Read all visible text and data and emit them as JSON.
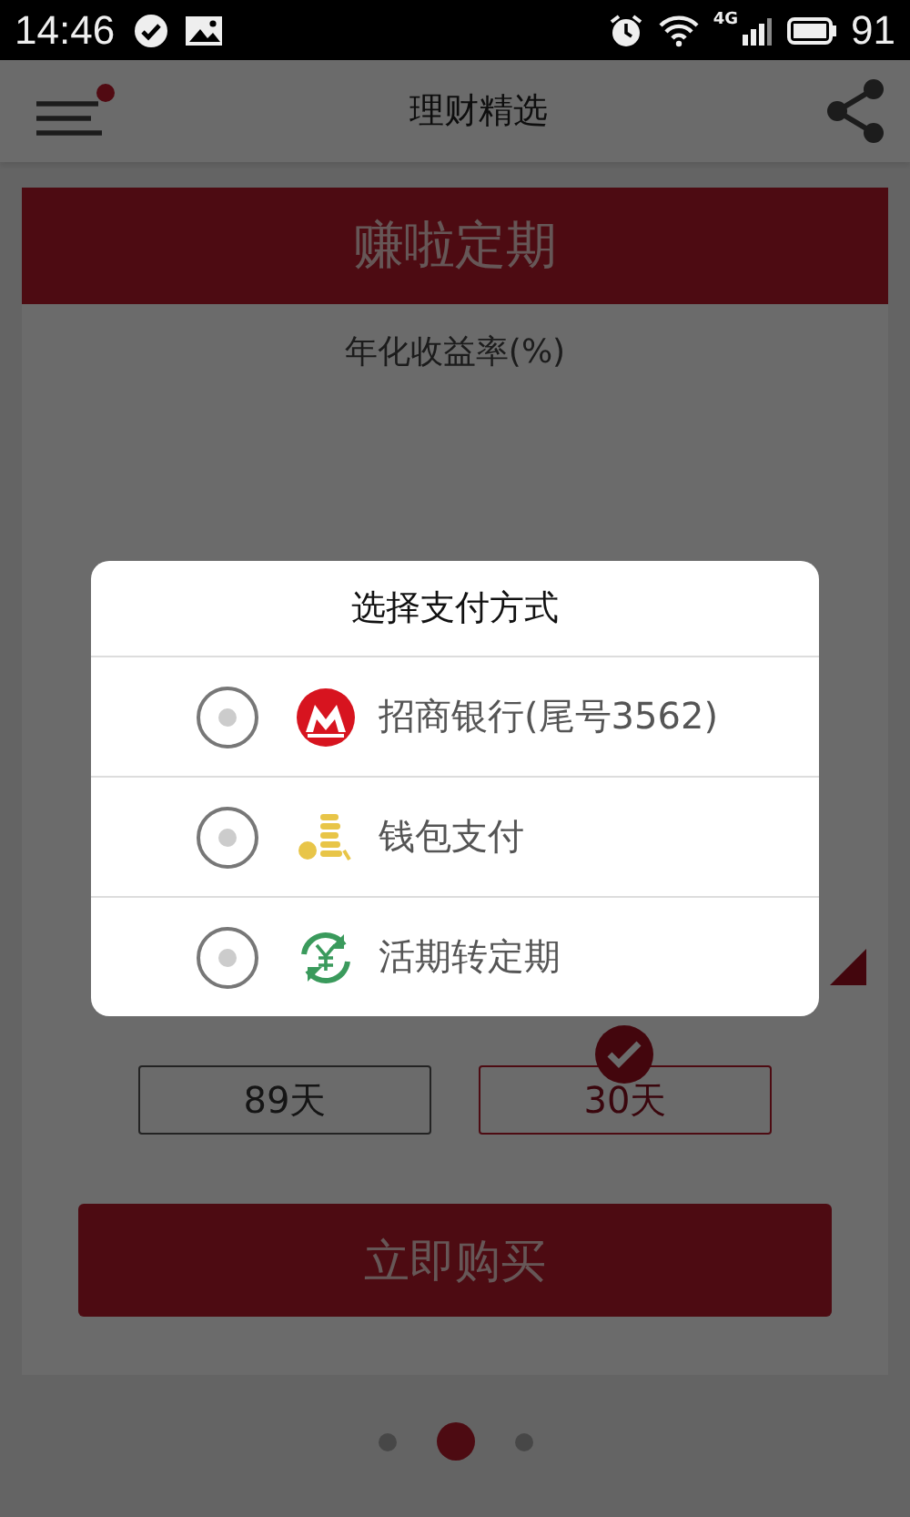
{
  "status_bar": {
    "time": "14:46",
    "network": "4G",
    "battery": "91"
  },
  "app_bar": {
    "title": "理财精选",
    "menu_badge": true
  },
  "product": {
    "name": "赚啦定期",
    "rate_label": "年化收益率(%)"
  },
  "terms": [
    {
      "label": "89天",
      "selected": false
    },
    {
      "label": "30天",
      "selected": true
    }
  ],
  "buy_button": "立即购买",
  "pager": [
    {
      "selected": false
    },
    {
      "selected": true
    },
    {
      "selected": false
    }
  ],
  "dialog": {
    "title": "选择支付方式",
    "options": [
      {
        "label": "招商银行(尾号3562)",
        "kind": "bank",
        "selected": false
      },
      {
        "label": "钱包支付",
        "kind": "wallet",
        "selected": false
      },
      {
        "label": "活期转定期",
        "kind": "transfer",
        "selected": false
      }
    ]
  }
}
